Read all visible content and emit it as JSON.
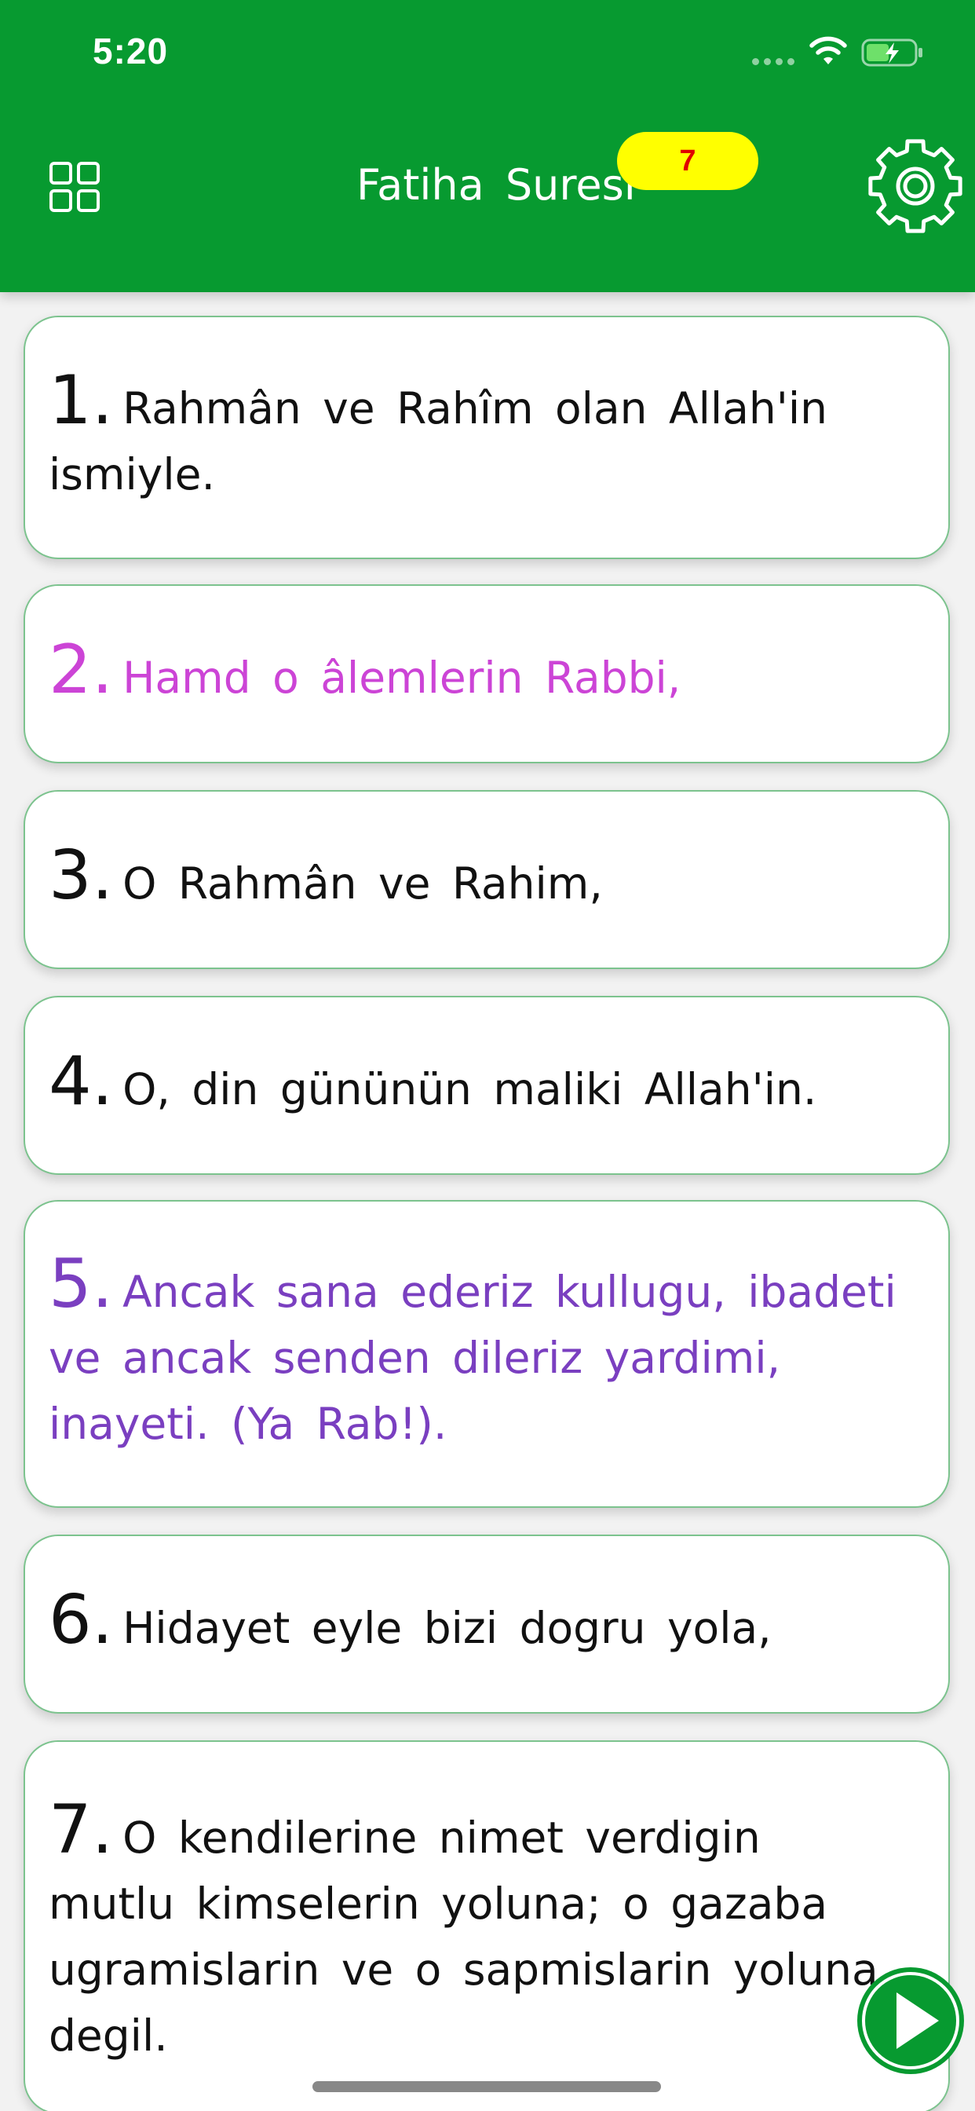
{
  "status_bar": {
    "time": "5:20"
  },
  "header": {
    "title": "Fatiha Suresi",
    "badge_count": "7",
    "menu_icon": "grid-icon",
    "settings_icon": "gear-icon"
  },
  "verses": [
    {
      "number": "1.",
      "text": "Rahmân ve Rahîm olan Allah'in ismiyle.",
      "color": "#111111"
    },
    {
      "number": "2.",
      "text": "Hamd o âlemlerin Rabbi,",
      "color": "#cc44d6"
    },
    {
      "number": "3.",
      "text": "O Rahmân ve Rahim,",
      "color": "#111111"
    },
    {
      "number": "4.",
      "text": "O, din gününün maliki Allah'in.",
      "color": "#111111"
    },
    {
      "number": "5.",
      "text": "Ancak sana ederiz kullugu, ibadeti ve ancak senden dileriz yardimi, inayeti. (Ya Rab!).",
      "color": "#7a3fc0"
    },
    {
      "number": "6.",
      "text": "Hidayet eyle bizi dogru yola,",
      "color": "#111111"
    },
    {
      "number": "7.",
      "text": "O kendilerine nimet verdigin mutlu kimselerin yoluna; o gazaba ugramislarin ve o sapmislarin yoluna degil.",
      "color": "#111111"
    }
  ],
  "colors": {
    "header_green": "#079a30",
    "badge_yellow": "#ffff00",
    "badge_text_red": "#e00000",
    "card_border": "#7cc38e"
  },
  "controls": {
    "play_icon": "play-icon"
  }
}
